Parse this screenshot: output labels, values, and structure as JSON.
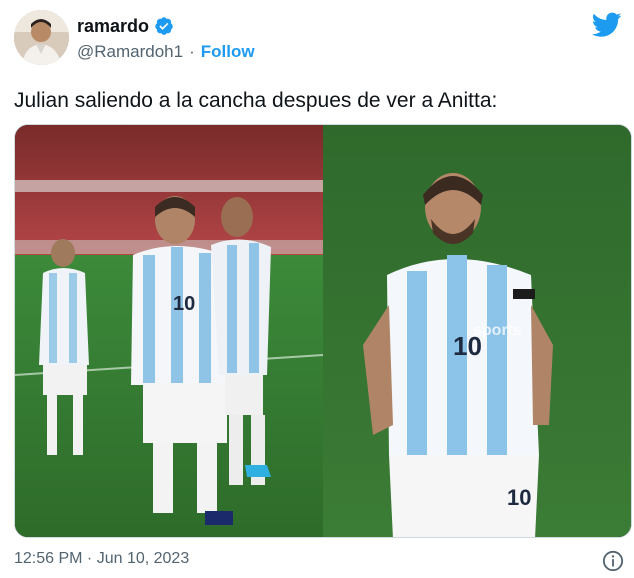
{
  "author": {
    "display_name": "ramardo",
    "handle": "@Ramardoh1",
    "separator": "·",
    "follow_label": "Follow",
    "verified": true
  },
  "tweet": {
    "text": "Julian saliendo a la cancha despues de ver a Anitta:",
    "timestamp": "12:56 PM · Jun 10, 2023"
  },
  "media": {
    "watermark": "sports",
    "jersey_number": "10"
  },
  "colors": {
    "brand_blue": "#1d9bf0",
    "text_primary": "#0f1419",
    "text_secondary": "#536471",
    "pitch_green": "#2e6b2a"
  },
  "icons": {
    "logo": "twitter-bird-icon",
    "verified": "verified-badge-icon",
    "info": "info-icon"
  }
}
